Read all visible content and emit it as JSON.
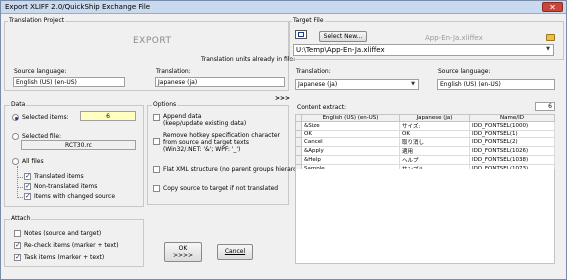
{
  "window": {
    "title": "Export XLIFF 2.0/QuickShip Exchange File",
    "close": "✕"
  },
  "translation_project": {
    "group_title": "Translation Project",
    "export_label": "EXPORT",
    "units_note": "Translation units already in file:",
    "source_language_label": "Source language:",
    "source_language_value": "English (US) (en-US)",
    "translation_label": "Translation:",
    "translation_value": "Japanese (ja)"
  },
  "data": {
    "group_title": "Data",
    "selected_items_label": "Selected items:",
    "selected_items_count": "6",
    "selected_file_label": "Selected file:",
    "selected_file_value": "RCT30.rc",
    "all_files_label": "All files",
    "translated_items_label": "Translated items",
    "non_translated_items_label": "Non-translated items",
    "changed_source_label": "Items with changed source"
  },
  "options": {
    "group_title": "Options",
    "append_line1": "Append data",
    "append_line2": "(keep/update existing data)",
    "remove_line1": "Remove hotkey specification character",
    "remove_line2": "from source and target texts",
    "remove_line3": "(Win32/.NET: '&'; WPF: '_')",
    "flat_xml_label": "Flat XML structure (no parent groups hierarchy)",
    "copy_source_label": "Copy source to target if not translated"
  },
  "attach": {
    "group_title": "Attach",
    "notes_label": "Notes (source and target)",
    "recheck_label": "Re-check items (marker + text)",
    "task_label": "Task items (marker + text)"
  },
  "buttons": {
    "ok_line1": "OK",
    "ok_line2": ">>>>",
    "cancel": "Cancel"
  },
  "arrow_between": ">>>",
  "target_file": {
    "group_title": "Target File",
    "select_new_label": "Select New...",
    "file_name": "App-En-Ja.xliffex",
    "path": "U:\\Temp\\App-En-Ja.xliffex",
    "translation_label": "Translation:",
    "translation_value": "Japanese (ja)",
    "source_language_label": "Source language:",
    "source_language_value": "English (US) (en-US)",
    "content_extract_label": "Content extract:",
    "content_extract_count": "6"
  },
  "extract_table": {
    "columns": [
      "English (US) (en-US)",
      "Japanese (ja)",
      "Name/ID"
    ],
    "rows": [
      [
        "&Size",
        "サイズ:",
        "IDD_FONTSEL(1000)"
      ],
      [
        "OK",
        "OK",
        "IDD_FONTSEL(1)"
      ],
      [
        "Cancel",
        "取り消し",
        "IDD_FONTSEL(2)"
      ],
      [
        "&Apply",
        "適用",
        "IDD_FONTSEL(1026)"
      ],
      [
        "&Help",
        "ヘルプ",
        "IDD_FONTSEL(1038)"
      ],
      [
        "Sample",
        "サンプル",
        "IDD_FONTSEL(1073)"
      ]
    ]
  },
  "icons": [
    "close-icon",
    "select-new-icon",
    "folder-icon",
    "dropdown-arrow-icon"
  ],
  "colors": {
    "titlebar": "#c9d9ee",
    "selected_items_field": "#ffffc0",
    "accent": "#1a3a8a"
  }
}
